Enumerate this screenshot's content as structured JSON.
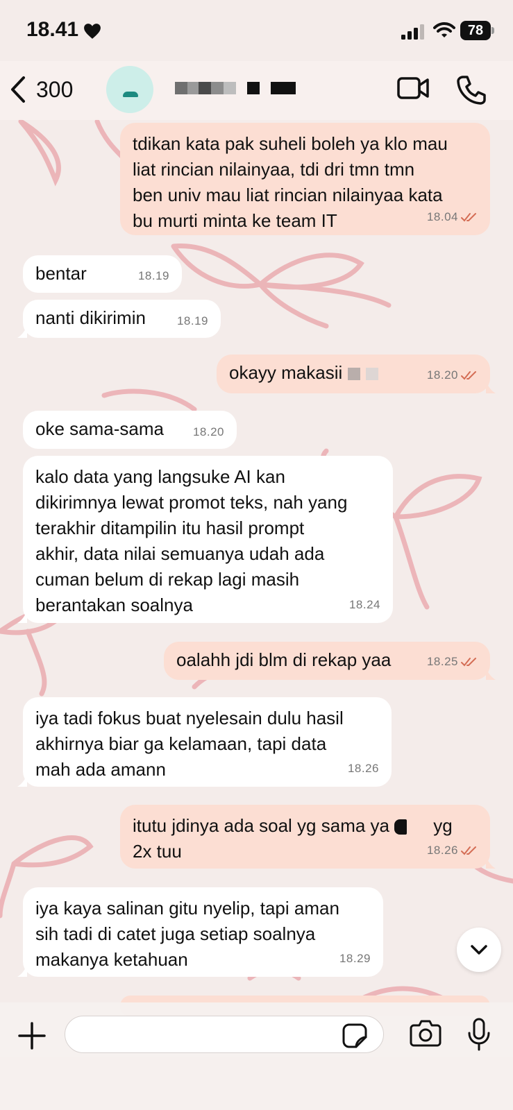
{
  "status_bar": {
    "time": "18.41",
    "battery": "78"
  },
  "header": {
    "back_count": "300"
  },
  "messages": [
    {
      "dir": "out",
      "text": "tdikan kata pak suheli boleh ya klo mau\nliat rincian nilainyaa, tdi dri tmn tmn\nben univ mau liat rincian nilainyaa kata\nbu murti minta ke team IT",
      "time": "18.04"
    },
    {
      "dir": "in",
      "text": "bentar",
      "time": "18.19"
    },
    {
      "dir": "in",
      "text": "nanti dikirimin",
      "time": "18.19"
    },
    {
      "dir": "out",
      "text": "okayy makasii",
      "time": "18.20"
    },
    {
      "dir": "in",
      "text": "oke sama-sama",
      "time": "18.20"
    },
    {
      "dir": "in",
      "text": "kalo data yang langsuke AI kan\ndikirimnya lewat promot teks, nah yang\nterakhir ditampilin itu hasil prompt\nakhir, data nilai semuanya udah ada\ncuman belum di rekap lagi masih\nberantakan soalnya",
      "time": "18.24"
    },
    {
      "dir": "out",
      "text": "oalahh jdi blm di rekap yaa",
      "time": "18.25"
    },
    {
      "dir": "in",
      "text": "iya tadi fokus buat nyelesain dulu hasil\nakhirnya biar ga kelamaan, tapi data\nmah ada amann",
      "time": "18.26"
    },
    {
      "dir": "out",
      "text": "itutu jdinya ada soal yg sama ya ",
      "text2": "yg\n2x tuu",
      "time": "18.26"
    },
    {
      "dir": "in",
      "text": "iya kaya salinan gitu nyelip, tapi aman\nsih tadi di catet juga setiap soalnya\nmakanya ketahuan",
      "time": "18.29"
    }
  ],
  "input": {
    "placeholder": ""
  },
  "colors": {
    "incoming_bubble": "#ffffff",
    "outgoing_bubble": "#fcded3",
    "read_ticks": "#d46d55",
    "wallpaper": "#f4ecea",
    "ribbon": "#e9a3a8"
  },
  "icons": [
    "heart-icon",
    "signal-icon",
    "wifi-icon",
    "battery-icon",
    "chevron-left-icon",
    "video-camera-icon",
    "phone-icon",
    "double-check-icon",
    "chevron-down-icon",
    "plus-icon",
    "sticker-icon",
    "camera-icon",
    "microphone-icon"
  ]
}
